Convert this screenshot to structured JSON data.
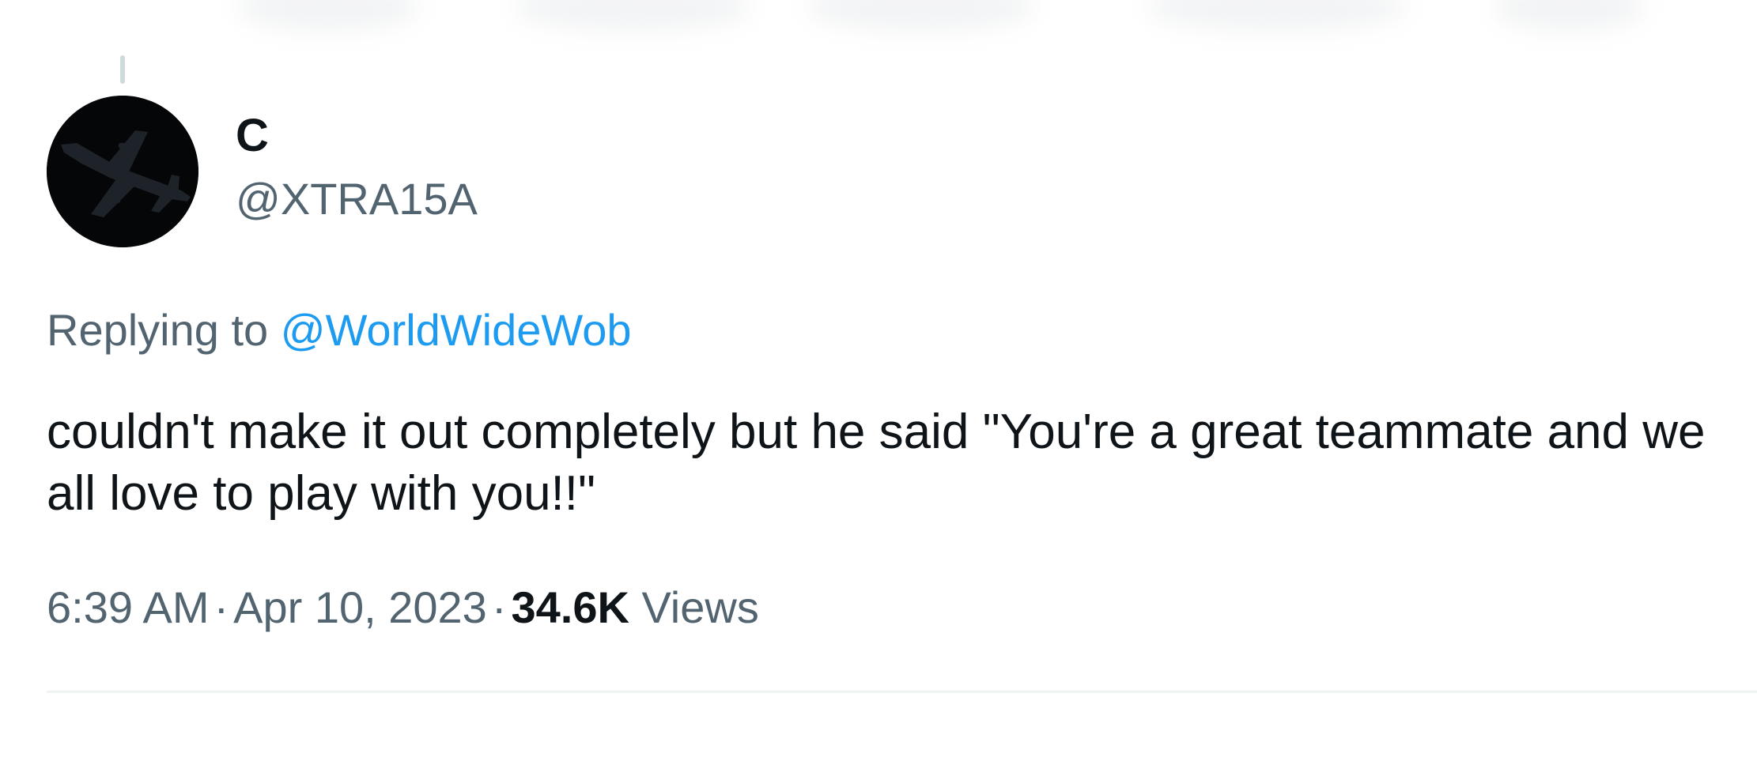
{
  "tweet": {
    "author": {
      "display_name": "C",
      "handle": "@XTRA15A",
      "avatar_icon": "airplane-silhouette-icon"
    },
    "replying_to": {
      "prefix": "Replying to",
      "mention": "@WorldWideWob"
    },
    "text": "couldn't make it out completely but he said \"You're a great teammate and we all love to play with you!!\"",
    "meta": {
      "time": "6:39 AM",
      "separator": "·",
      "date": "Apr 10, 2023",
      "views_count": "34.6K",
      "views_label": "Views"
    }
  },
  "colors": {
    "text_primary": "#0f1419",
    "text_secondary": "#536471",
    "link": "#1d9bf0",
    "divider": "#eff3f4",
    "thread_line": "#cfd9de"
  }
}
